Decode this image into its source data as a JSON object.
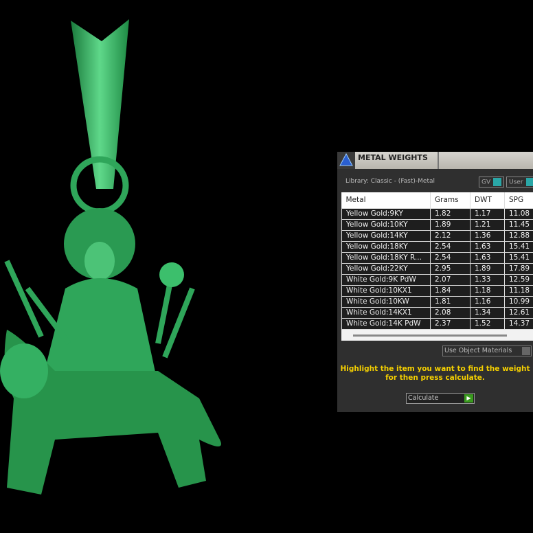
{
  "panel": {
    "title": "METAL WEIGHTS",
    "library": "Library: Classic - (Fast)-Metal",
    "toggle_gv": "GV",
    "toggle_user": "User",
    "columns": [
      "Metal",
      "Grams",
      "DWT",
      "SPG"
    ],
    "rows": [
      [
        "Yellow Gold:9KY",
        "1.82",
        "1.17",
        "11.08"
      ],
      [
        "Yellow Gold:10KY",
        "1.89",
        "1.21",
        "11.45"
      ],
      [
        "Yellow Gold:14KY",
        "2.12",
        "1.36",
        "12.88"
      ],
      [
        "Yellow Gold:18KY",
        "2.54",
        "1.63",
        "15.41"
      ],
      [
        "Yellow Gold:18KY R...",
        "2.54",
        "1.63",
        "15.41"
      ],
      [
        "Yellow Gold:22KY",
        "2.95",
        "1.89",
        "17.89"
      ],
      [
        "White Gold:9K PdW",
        "2.07",
        "1.33",
        "12.59"
      ],
      [
        "White Gold:10KX1",
        "1.84",
        "1.18",
        "11.18"
      ],
      [
        "White Gold:10KW",
        "1.81",
        "1.16",
        "10.99"
      ],
      [
        "White Gold:14KX1",
        "2.08",
        "1.34",
        "12.61"
      ],
      [
        "White Gold:14K PdW",
        "2.37",
        "1.52",
        "14.37"
      ]
    ],
    "use_object_materials": "Use Object Materials",
    "message": "Highlight the item you want to find the weight for then press calculate.",
    "calculate": "Calculate"
  },
  "colors": {
    "pendant": "#2fa65a",
    "message": "#f5d000",
    "toggle": "#2aa7a7",
    "calc_arrow": "#3a9a1e"
  }
}
